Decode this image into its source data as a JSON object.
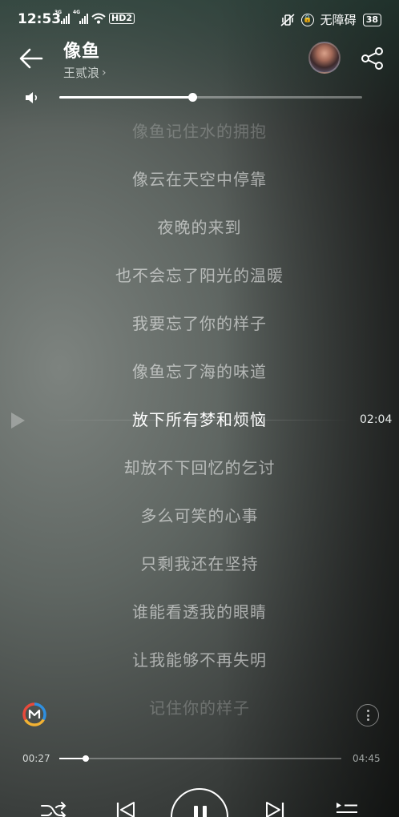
{
  "status_bar": {
    "time": "12:53",
    "sim1_net": "3G",
    "sim2_net": "4G",
    "hd_label": "HD2",
    "accessibility_label": "无障碍",
    "battery": "38"
  },
  "song": {
    "title": "像鱼",
    "artist": "王贰浪"
  },
  "volume": {
    "level_percent": 44
  },
  "lyrics": {
    "lines": [
      "像鱼记住水的拥抱",
      "像云在天空中停靠",
      "夜晚的来到",
      "也不会忘了阳光的温暖",
      "我要忘了你的样子",
      "像鱼忘了海的味道",
      "放下所有梦和烦恼",
      "却放不下回忆的乞讨",
      "多么可笑的心事",
      "只剩我还在坚持",
      "谁能看透我的眼睛",
      "让我能够不再失明",
      "记住你的样子"
    ],
    "current_index": 6,
    "current_line_time": "02:04"
  },
  "playback": {
    "current_time": "00:27",
    "total_time": "04:45",
    "progress_percent": 9.5
  },
  "icons": {
    "back": "arrow-left-icon",
    "share": "share-icon",
    "volume": "speaker-icon",
    "more": "more-vertical-icon",
    "shuffle": "shuffle-icon",
    "prev": "skip-previous-icon",
    "pause": "pause-icon",
    "next": "skip-next-icon",
    "playlist": "playlist-icon"
  },
  "colors": {
    "accent": "#ffffff",
    "logo_red": "#e84a3c",
    "logo_blue": "#2f8fe0",
    "logo_yellow": "#f2b233"
  }
}
